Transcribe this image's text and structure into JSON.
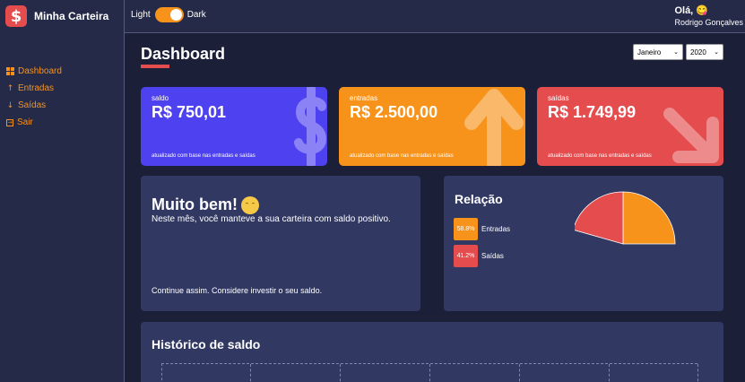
{
  "brand": {
    "name": "Minha Carteira",
    "logo_symbol": "$"
  },
  "menu": [
    {
      "label": "Dashboard",
      "icon": "grid-icon"
    },
    {
      "label": "Entradas",
      "icon": "arrow-up-icon"
    },
    {
      "label": "Saídas",
      "icon": "arrow-down-icon"
    },
    {
      "label": "Sair",
      "icon": "exit-icon"
    }
  ],
  "theme_toggle": {
    "left_label": "Light",
    "right_label": "Dark",
    "state": "dark"
  },
  "profile": {
    "greeting": "Olá, 😋",
    "name": "Rodrigo Gonçalves"
  },
  "page": {
    "title": "Dashboard"
  },
  "filters": {
    "month": "Janeiro",
    "year": "2020"
  },
  "cards": [
    {
      "label": "saldo",
      "value": "R$ 750,01",
      "note": "atualizado com base nas entradas e saídas",
      "color": "#4e41f0",
      "icon": "dollar-icon"
    },
    {
      "label": "entradas",
      "value": "R$ 2.500,00",
      "note": "atualizado com base nas entradas e saídas",
      "color": "#f7931b",
      "icon": "arrow-up-icon"
    },
    {
      "label": "saídas",
      "value": "R$ 1.749,99",
      "note": "atualizado com base nas entradas e saídas",
      "color": "#e44c4e",
      "icon": "arrow-down-icon"
    }
  ],
  "message": {
    "title": "Muito bem!",
    "emoji": "happy-face-icon",
    "description": "Neste mês, você manteve a sua carteira com saldo positivo.",
    "footer": "Continue assim. Considere investir o seu saldo."
  },
  "relation": {
    "title": "Relação",
    "items": [
      {
        "percent": "58.8%",
        "label": "Entradas",
        "color": "#f7931b"
      },
      {
        "percent": "41.2%",
        "label": "Saídas",
        "color": "#e44c4e"
      }
    ]
  },
  "chart_data": {
    "type": "pie",
    "categories": [
      "Entradas",
      "Saídas"
    ],
    "values": [
      58.8,
      41.2
    ],
    "colors": [
      "#f7931b",
      "#e44c4e"
    ]
  },
  "history": {
    "title": "Histórico de saldo"
  },
  "colors": {
    "accent": "#f7931b",
    "danger": "#e44c4e",
    "primary": "#4e41f0",
    "panel": "#313862",
    "background": "#1b1f38"
  }
}
